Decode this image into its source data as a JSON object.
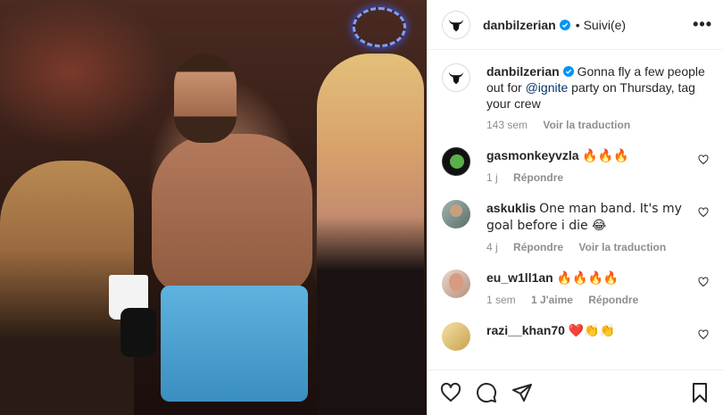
{
  "post": {
    "username": "danbilzerian",
    "dot": "•",
    "follow_status": "Suivi(e)",
    "more_label": "•••",
    "caption_prefix": "Gonna fly a few people out for ",
    "caption_mention": "@ignite",
    "caption_suffix": " party on Thursday, tag your crew",
    "caption_time": "143 sem",
    "caption_translate": "Voir la traduction"
  },
  "comments": [
    {
      "username": "gasmonkeyvzla",
      "text": "🔥🔥🔥",
      "time": "1 j",
      "reply": "Répondre",
      "likes": "",
      "translate": ""
    },
    {
      "username": "askuklis",
      "text": "One man band. It's my goal before i die 😂",
      "time": "4 j",
      "reply": "Répondre",
      "likes": "",
      "translate": "Voir la traduction"
    },
    {
      "username": "eu_w1ll1an",
      "text": "🔥🔥🔥🔥",
      "time": "1 sem",
      "reply": "Répondre",
      "likes": "1 J'aime",
      "translate": ""
    },
    {
      "username": "razi__khan70",
      "text": "❤️👏👏",
      "time": "",
      "reply": "",
      "likes": "",
      "translate": ""
    }
  ],
  "icons": [
    "like-icon",
    "comment-icon",
    "share-icon",
    "save-icon",
    "verified-icon",
    "heart-icon",
    "more-icon"
  ],
  "colors": {
    "verified": "#0095f6",
    "mention": "#00376b",
    "muted": "#8e8e8e"
  }
}
